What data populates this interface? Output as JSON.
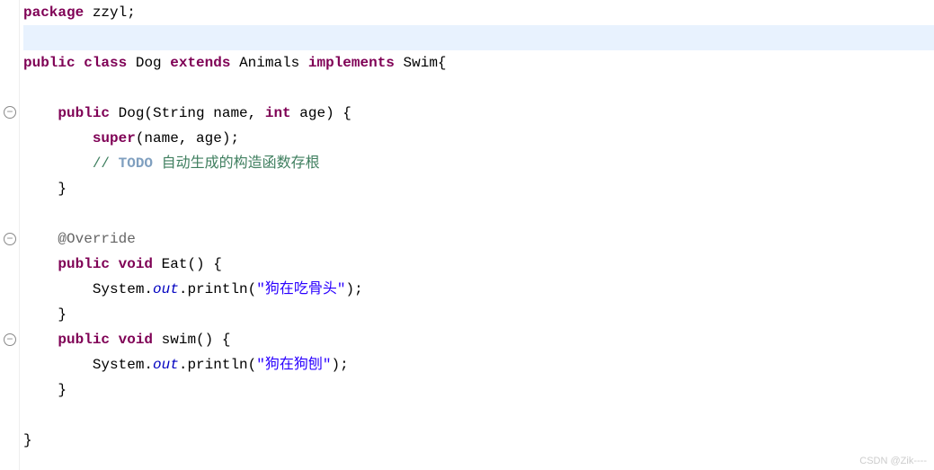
{
  "line1": {
    "kw_package": "package",
    "pkg": " zzyl;"
  },
  "line3": {
    "kw_public": "public",
    "kw_class": "class",
    "class_name": " Dog ",
    "kw_extends": "extends",
    "parent": " Animals ",
    "kw_implements": "implements",
    "iface": " Swim{"
  },
  "line5": {
    "kw_public": "public",
    "ctor": " Dog(String name, ",
    "kw_int": "int",
    "rest": " age) {"
  },
  "line6": {
    "kw_super": "super",
    "rest": "(name, age);"
  },
  "line7": {
    "comment_prefix": "// ",
    "todo": "TODO",
    "comment_text": " 自动生成的构造函数存根"
  },
  "line8": {
    "brace": "    }"
  },
  "line10": {
    "ann": "@Override"
  },
  "line11": {
    "kw_public": "public",
    "kw_void": "void",
    "method": " Eat() {"
  },
  "line12": {
    "sys": "        System.",
    "out": "out",
    "print": ".println(",
    "str": "\"狗在吃骨头\"",
    "end": ");"
  },
  "line13": {
    "brace": "    }"
  },
  "line14": {
    "kw_public": "public",
    "kw_void": "void",
    "method": " swim() {"
  },
  "line15": {
    "sys": "        System.",
    "out": "out",
    "print": ".println(",
    "str": "\"狗在狗刨\"",
    "end": ");"
  },
  "line16": {
    "brace": "    }"
  },
  "line18": {
    "brace": "}"
  },
  "gutter": {
    "minus": "−"
  },
  "watermark": "CSDN @Zik----"
}
